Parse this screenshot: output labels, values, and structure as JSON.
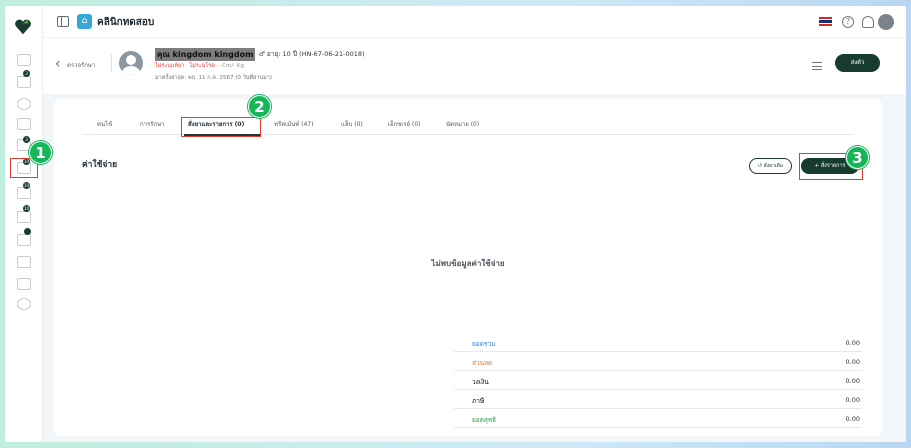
{
  "app": {
    "clinic_name": "คลินิกทดสอบ"
  },
  "callouts": [
    "1",
    "2",
    "3"
  ],
  "sidebar": {
    "badges": [
      "3",
      "3",
      "10",
      "10",
      "10"
    ]
  },
  "patient": {
    "back_label": "ตรวจรักษา",
    "name": "คุณ kingdom kingdom",
    "meta": "♂ อายุ: 10 ปี (HN-67-06-21-0018)",
    "allergy": "ไม่ระบุแพ้ยา",
    "disease": "ไม่ระบุโรค",
    "body": "· -Cm/- Kg",
    "last_visit": "มาครั้งล่าสุด: พฤ. 11 ก.ค. 2567 (0 วันที่ผ่านมา)",
    "checkin_label": "ส่งตัว"
  },
  "tabs": [
    {
      "label": "คนไข้"
    },
    {
      "label": "การรักษา"
    },
    {
      "label": "สั่งยาและรายการ (0)"
    },
    {
      "label": "ทรีทเม้นท์ (47)"
    },
    {
      "label": "แล็บ (0)"
    },
    {
      "label": "เอ็กซเรย์ (0)"
    },
    {
      "label": "นัดหมาย (0)"
    }
  ],
  "expenses": {
    "title": "ค่าใช้จ่าย",
    "history_label": "สั่งยาเดิม",
    "add_label": "+ สั่งรายการ",
    "empty_text": "ไม่พบข้อมูลค่าใช้จ่าย",
    "totals": [
      {
        "label": "ยอดรวม",
        "value": "0.00",
        "color": "#2e7dd6"
      },
      {
        "label": "ส่วนลด",
        "value": "0.00",
        "color": "#e5762c"
      },
      {
        "label": "วงเงิน",
        "value": "0.00",
        "color": "#333333"
      },
      {
        "label": "ภาษี",
        "value": "0.00",
        "color": "#333333"
      },
      {
        "label": "ยอดสุทธิ",
        "value": "0.00",
        "color": "#2e9b4f"
      }
    ]
  }
}
